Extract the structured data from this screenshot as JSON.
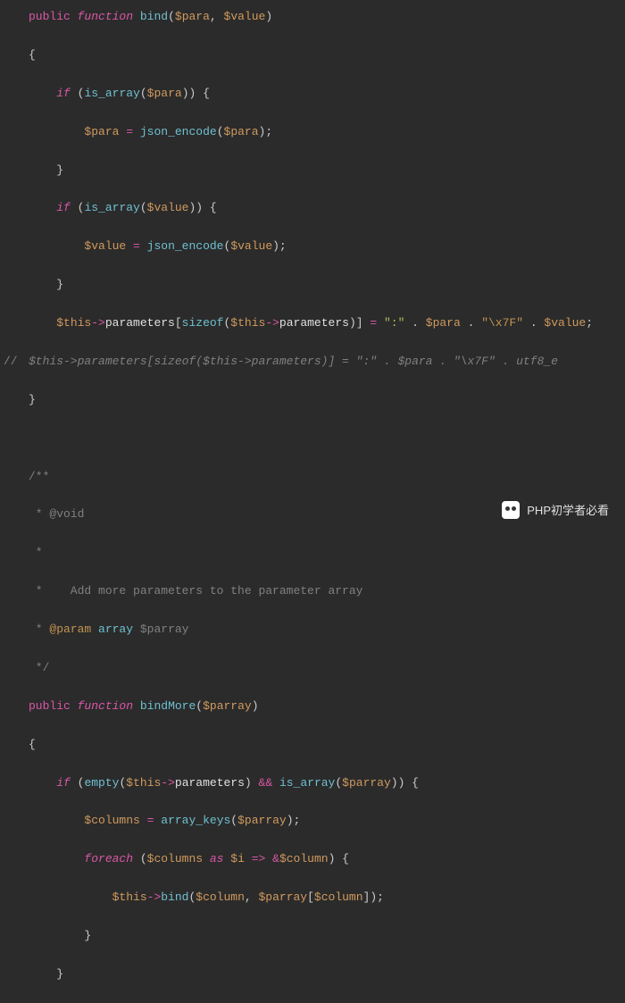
{
  "code": {
    "l1": {
      "public": "public",
      "function": "function",
      "name": "bind",
      "p1": "$para",
      "p2": "$value"
    },
    "l2": "{",
    "l3": {
      "if": "if",
      "call": "is_array",
      "arg": "$para"
    },
    "l4": {
      "var": "$para",
      "call": "json_encode",
      "arg": "$para"
    },
    "l5": "}",
    "l6": {
      "if": "if",
      "call": "is_array",
      "arg": "$value"
    },
    "l7": {
      "var": "$value",
      "call": "json_encode",
      "arg": "$value"
    },
    "l8": "}",
    "l9": {
      "this": "$this",
      "prop": "parameters",
      "sizeof": "sizeof",
      "this2": "$this",
      "prop2": "parameters",
      "str1": "\":\"",
      "var1": "$para",
      "esc": "\"\\x7F\"",
      "var2": "$value"
    },
    "l10": {
      "gutter": "//",
      "text": "$this->parameters[sizeof($this->parameters)] = \":\" . $para . \"\\x7F\" . utf8_e"
    },
    "l11": "}",
    "doc": {
      "start": "/**",
      "void": " * @void",
      "star1": " *",
      "desc": " *    Add more parameters to the parameter array",
      "param_tag": "@param",
      "param_type": "array",
      "param_name": "$parray",
      "end": " */"
    },
    "l18": {
      "public": "public",
      "function": "function",
      "name": "bindMore",
      "p1": "$parray"
    },
    "l19": "{",
    "l20": {
      "if": "if",
      "empty": "empty",
      "this": "$this",
      "prop": "parameters",
      "and": "&&",
      "isarr": "is_array",
      "arg": "$parray"
    },
    "l21": {
      "var": "$columns",
      "call": "array_keys",
      "arg": "$parray"
    },
    "l22": {
      "foreach": "foreach",
      "cols": "$columns",
      "as": "as",
      "i": "$i",
      "arrow": "=>",
      "amp": "&",
      "col": "$column"
    },
    "l23": {
      "this": "$this",
      "bind": "bind",
      "col": "$column",
      "parr": "$parray",
      "col2": "$column"
    },
    "l24": "}",
    "l25": "}"
  },
  "watermark": "PHP初学者必看"
}
